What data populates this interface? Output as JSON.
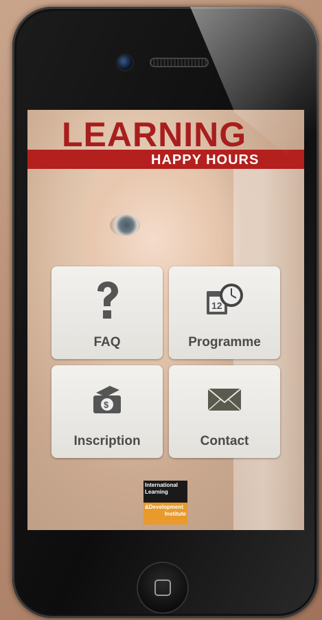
{
  "app": {
    "title_main": "LEARNING",
    "title_sub": "HAPPY HOURS"
  },
  "menu": {
    "items": [
      {
        "label": "FAQ",
        "icon": "question-mark-icon"
      },
      {
        "label": "Programme",
        "icon": "calendar-clock-icon"
      },
      {
        "label": "Inscription",
        "icon": "money-wallet-icon"
      },
      {
        "label": "Contact",
        "icon": "envelope-icon"
      }
    ]
  },
  "logo": {
    "line1": "International",
    "line2": "Learning",
    "line3": "&Development",
    "line4": "Institute"
  },
  "colors": {
    "brand_red": "#b3201e",
    "tile_text": "#4a4a4a",
    "logo_orange": "#e89a2c"
  }
}
